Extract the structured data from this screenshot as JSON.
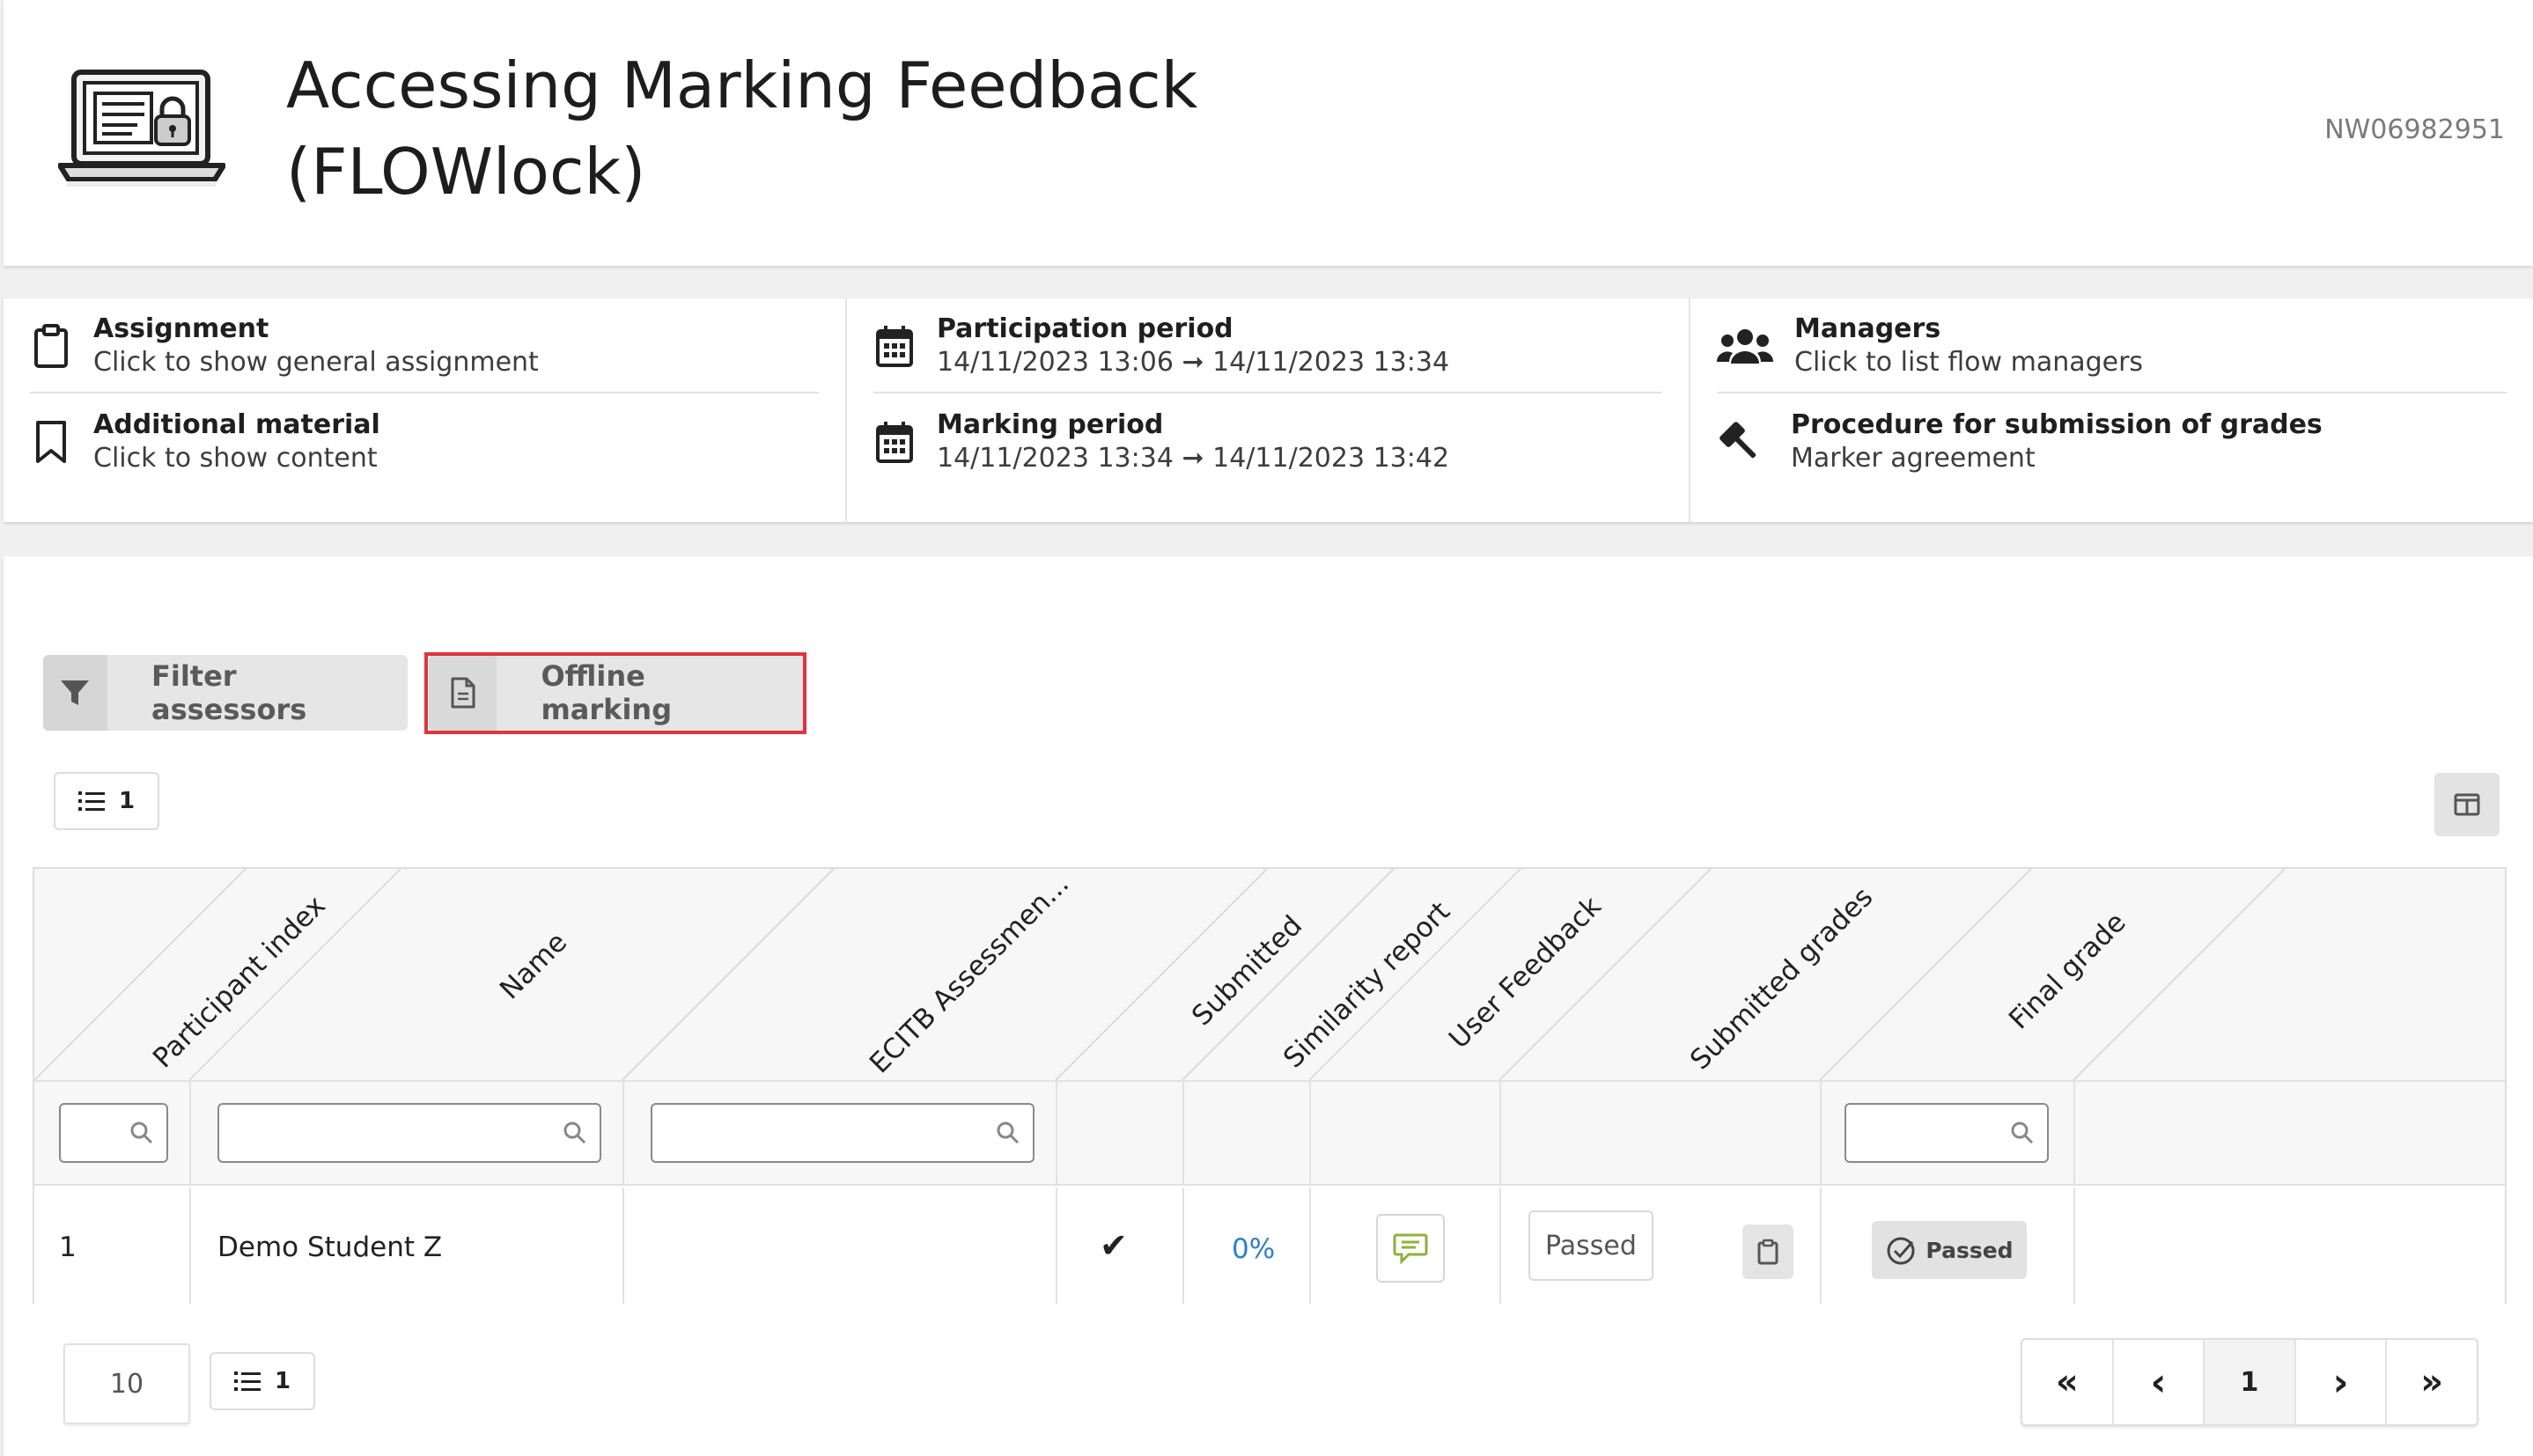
{
  "header": {
    "title_line1": "Accessing Marking Feedback",
    "title_line2": "(FLOWlock)",
    "ref_id": "NW06982951",
    "icon": "laptop-lock-icon"
  },
  "info": {
    "assignment": {
      "title": "Assignment",
      "sub": "Click to show general assignment",
      "icon": "clipboard-icon"
    },
    "additional": {
      "title": "Additional material",
      "sub": "Click to show content",
      "icon": "bookmark-icon"
    },
    "participation": {
      "title": "Participation period",
      "start": "14/11/2023 13:06",
      "end": "14/11/2023 13:34",
      "icon": "calendar-icon"
    },
    "marking": {
      "title": "Marking period",
      "start": "14/11/2023 13:34",
      "end": "14/11/2023 13:42",
      "icon": "calendar-icon"
    },
    "managers": {
      "title": "Managers",
      "sub": "Click to list flow managers",
      "icon": "users-icon"
    },
    "procedure": {
      "title": "Procedure for submission of grades",
      "sub": "Marker agreement",
      "icon": "gavel-icon"
    }
  },
  "toolbar": {
    "filter_label": "Filter assessors",
    "offline_label": "Offline marking",
    "count": "1"
  },
  "table": {
    "headers": [
      "Participant index",
      "Name",
      "ECITB Assessmen...",
      "Submitted",
      "Similarity report",
      "User Feedback",
      "Submitted grades",
      "Final grade"
    ],
    "rows": [
      {
        "index": "1",
        "name": "Demo Student Z",
        "ecitb": "",
        "submitted": "✔",
        "similarity": "0%",
        "submitted_grade": "Passed",
        "final_grade": "Passed"
      }
    ]
  },
  "footer": {
    "per_page": "10",
    "count": "1",
    "current_page": "1",
    "first": "«",
    "prev": "‹",
    "next": "›",
    "last": "»"
  },
  "colors": {
    "highlight": "#e0343e",
    "link": "#2e7fcf",
    "feedback_icon": "#8fb13a"
  }
}
